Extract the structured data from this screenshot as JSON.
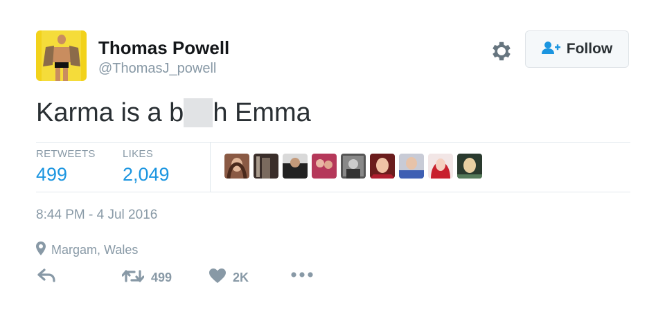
{
  "user": {
    "name": "Thomas Powell",
    "handle": "@ThomasJ_powell"
  },
  "header": {
    "follow_label": "Follow"
  },
  "tweet": {
    "text_before": "Karma is a b",
    "text_after": "h Emma"
  },
  "stats": {
    "retweets_label": "RETWEETS",
    "retweets_value": "499",
    "likes_label": "LIKES",
    "likes_value": "2,049"
  },
  "meta": {
    "timestamp": "8:44 PM - 4 Jul 2016",
    "location": "Margam, Wales"
  },
  "actions": {
    "retweet_count": "499",
    "like_count": "2K"
  },
  "colors": {
    "link_blue": "#1b95e0",
    "muted": "#8899a6",
    "text": "#292f33"
  }
}
